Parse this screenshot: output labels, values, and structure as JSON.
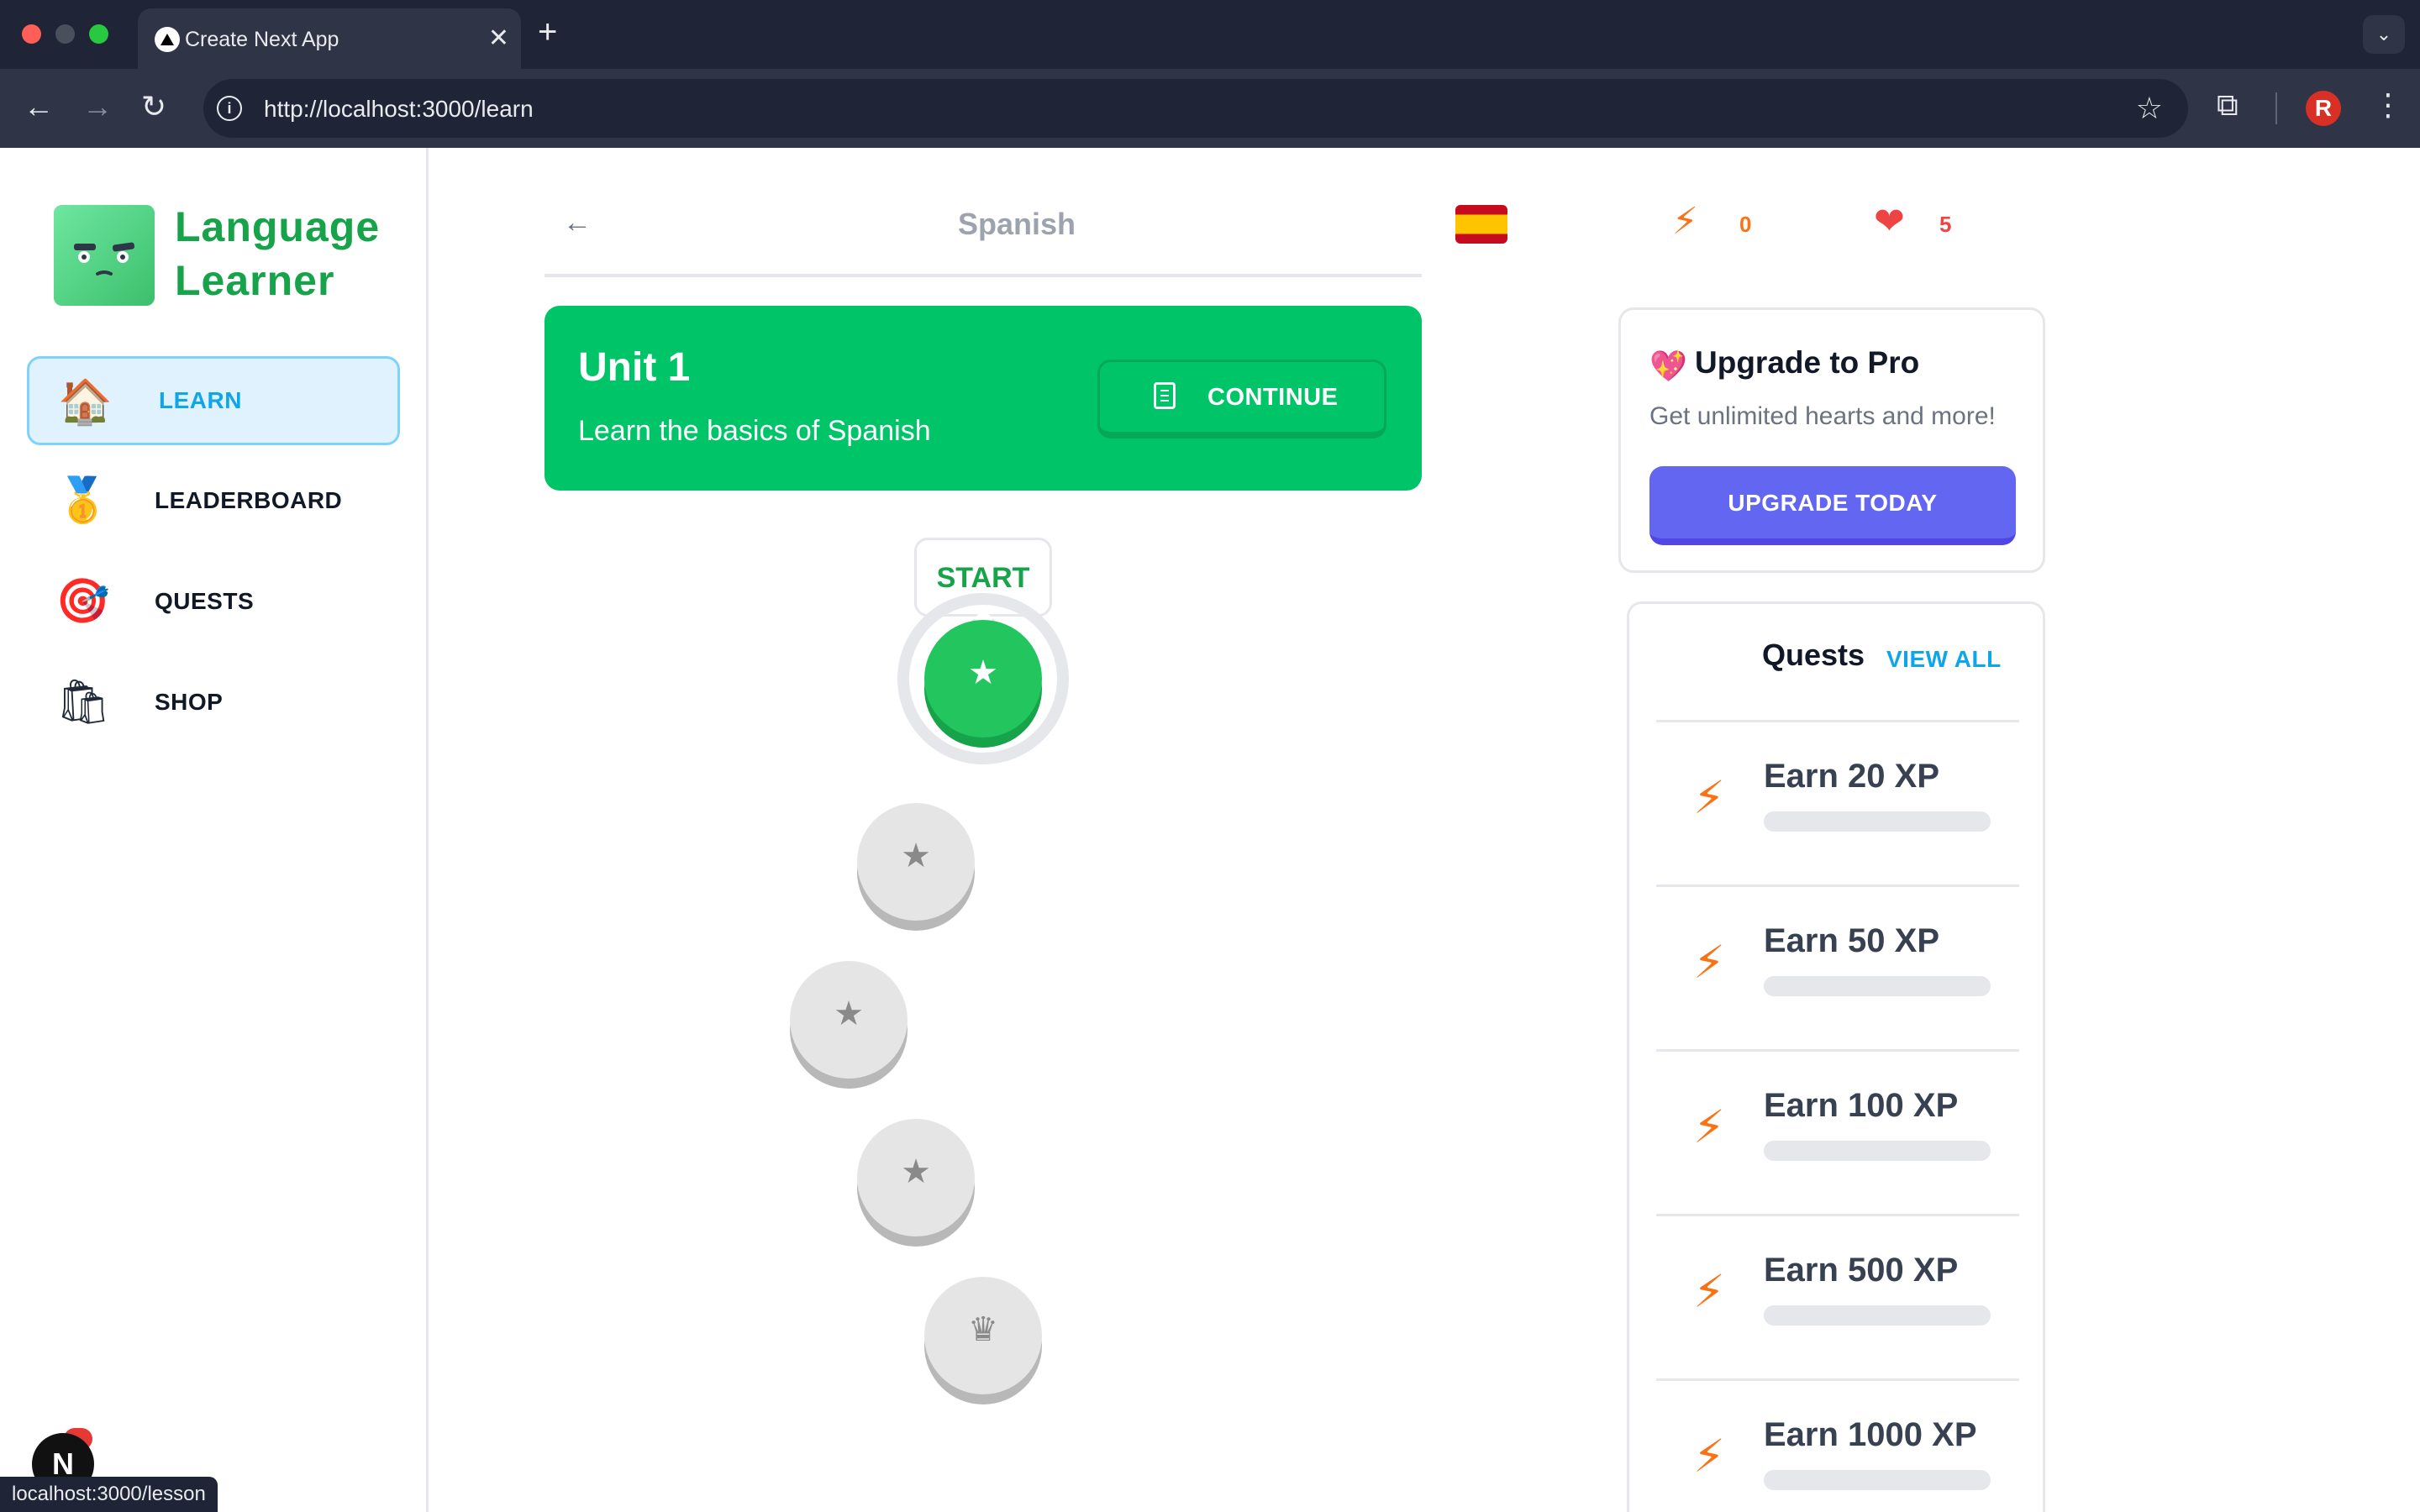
{
  "browser": {
    "tab_title": "Create Next App",
    "url": "http://localhost:3000/learn",
    "status_url": "localhost:3000/lesson",
    "profile_initial": "R"
  },
  "sidebar": {
    "brand_line1": "Language",
    "brand_line2": "Learner",
    "items": [
      {
        "label": "LEARN",
        "icon": "house-icon",
        "active": true
      },
      {
        "label": "LEADERBOARD",
        "icon": "medal-icon",
        "active": false
      },
      {
        "label": "QUESTS",
        "icon": "target-icon",
        "active": false
      },
      {
        "label": "SHOP",
        "icon": "shopping-bag-icon",
        "active": false
      }
    ],
    "next_badge": "N"
  },
  "header": {
    "course": "Spanish",
    "points": "0",
    "hearts": "5"
  },
  "unit": {
    "title": "Unit 1",
    "description": "Learn the basics of Spanish",
    "continue_label": "CONTINUE"
  },
  "lessons": {
    "start_label": "START",
    "nodes": [
      {
        "icon": "star-icon",
        "state": "current"
      },
      {
        "icon": "star-icon",
        "state": "locked"
      },
      {
        "icon": "star-icon",
        "state": "locked"
      },
      {
        "icon": "star-icon",
        "state": "locked"
      },
      {
        "icon": "crown-icon",
        "state": "locked"
      }
    ]
  },
  "promo": {
    "title": "Upgrade to Pro",
    "description": "Get unlimited hearts and more!",
    "button_label": "UPGRADE TODAY"
  },
  "quests": {
    "title": "Quests",
    "view_all": "VIEW ALL",
    "items": [
      {
        "label": "Earn 20 XP",
        "progress": 0
      },
      {
        "label": "Earn 50 XP",
        "progress": 0
      },
      {
        "label": "Earn 100 XP",
        "progress": 0
      },
      {
        "label": "Earn 500 XP",
        "progress": 0
      },
      {
        "label": "Earn 1000 XP",
        "progress": 0
      }
    ]
  },
  "colors": {
    "primary_green": "#00c468",
    "accent_blue": "#0ea5e9",
    "pro_button": "#6366f1",
    "heart_red": "#ef4444",
    "bolt_orange": "#f97316"
  }
}
